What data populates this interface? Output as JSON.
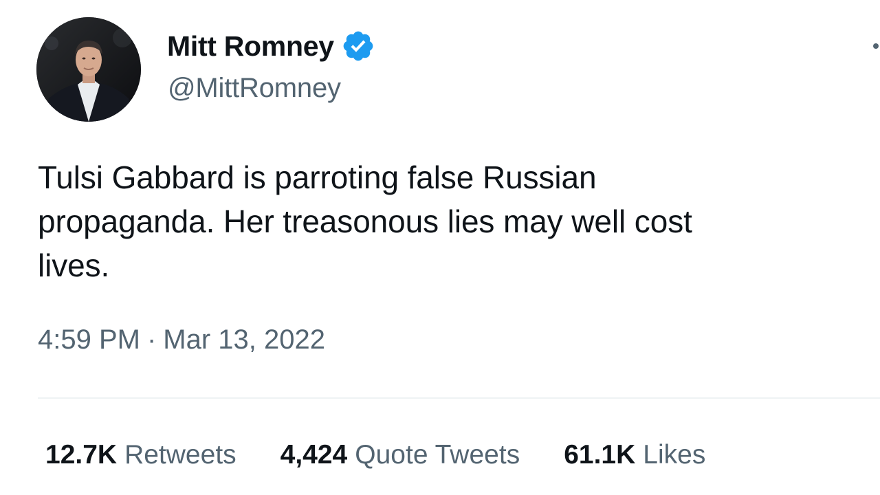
{
  "author": {
    "display_name": "Mitt Romney",
    "handle": "@MittRomney",
    "verified": true,
    "verified_color": "#1d9bf0"
  },
  "tweet": {
    "text": "Tulsi Gabbard is parroting false Russian\npropaganda. Her treasonous lies may well cost\nlives.",
    "time": "4:59 PM",
    "separator": "·",
    "date": "Mar 13, 2022"
  },
  "stats": {
    "retweets": {
      "count": "12.7K",
      "label": "Retweets"
    },
    "quote_tweets": {
      "count": "4,424",
      "label": "Quote Tweets"
    },
    "likes": {
      "count": "61.1K",
      "label": "Likes"
    }
  },
  "icons": {
    "verified": "verified-badge-icon",
    "more": "more-options-icon"
  }
}
